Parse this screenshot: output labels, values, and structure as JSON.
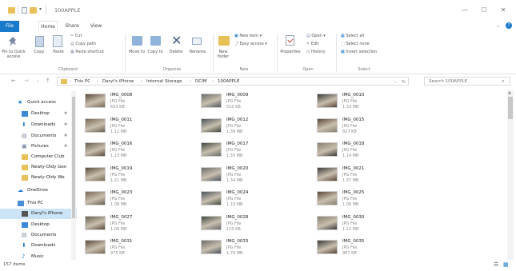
{
  "window": {
    "title": "100APPLE"
  },
  "tabs": [
    {
      "label": "File"
    },
    {
      "label": "Home"
    },
    {
      "label": "Share"
    },
    {
      "label": "View"
    }
  ],
  "ribbon": {
    "pin_label": "Pin to Quick access",
    "copy_label": "Copy",
    "paste_label": "Paste",
    "cut_label": "Cut",
    "copy_path_label": "Copy path",
    "paste_shortcut_label": "Paste shortcut",
    "move_to_label": "Move to",
    "copy_to_label": "Copy to",
    "delete_label": "Delete",
    "rename_label": "Rename",
    "new_folder_label": "New folder",
    "new_item_label": "New item",
    "easy_access_label": "Easy access",
    "properties_label": "Properties",
    "open_label": "Open",
    "edit_label": "Edit",
    "history_label": "History",
    "select_all_label": "Select all",
    "select_none_label": "Select none",
    "invert_selection_label": "Invert selection",
    "groups": [
      "Clipboard",
      "Organize",
      "New",
      "Open",
      "Select"
    ]
  },
  "address": {
    "crumbs": [
      "This PC",
      "Daryl's iPhone",
      "Internal Storage",
      "DCIM",
      "100APPLE"
    ],
    "search_placeholder": "Search 100APPLE"
  },
  "nav": [
    {
      "label": "Quick access",
      "icon": "star-icon",
      "pinned": false,
      "indent": 0
    },
    {
      "label": "Desktop",
      "icon": "desktop-icon",
      "pinned": true,
      "indent": 1
    },
    {
      "label": "Downloads",
      "icon": "download-icon",
      "pinned": true,
      "indent": 1
    },
    {
      "label": "Documents",
      "icon": "document-icon",
      "pinned": true,
      "indent": 1
    },
    {
      "label": "Pictures",
      "icon": "pictures-icon",
      "pinned": true,
      "indent": 1
    },
    {
      "label": "Computer Club",
      "icon": "folder-icon",
      "pinned": false,
      "indent": 1
    },
    {
      "label": "Newly-Oldy Gen",
      "icon": "folder-icon",
      "pinned": false,
      "indent": 1
    },
    {
      "label": "Newly-Oldy We",
      "icon": "folder-icon",
      "pinned": false,
      "indent": 1
    },
    {
      "label": "OneDrive",
      "icon": "cloud-icon",
      "pinned": false,
      "indent": 0
    },
    {
      "label": "This PC",
      "icon": "computer-icon",
      "pinned": false,
      "indent": 0
    },
    {
      "label": "Daryl's iPhone",
      "icon": "phone-icon",
      "pinned": false,
      "indent": 1,
      "selected": true
    },
    {
      "label": "Desktop",
      "icon": "desktop-icon",
      "pinned": false,
      "indent": 1
    },
    {
      "label": "Documents",
      "icon": "document-icon",
      "pinned": false,
      "indent": 1
    },
    {
      "label": "Downloads",
      "icon": "download-icon",
      "pinned": false,
      "indent": 1
    },
    {
      "label": "Music",
      "icon": "music-icon",
      "pinned": false,
      "indent": 1
    }
  ],
  "files": [
    {
      "name": "IMG_0008",
      "type": "JPG File",
      "size": "633 KB"
    },
    {
      "name": "IMG_0009",
      "type": "JPG File",
      "size": "510 KB"
    },
    {
      "name": "IMG_0010",
      "type": "JPG File",
      "size": "1.33 MB"
    },
    {
      "name": "IMG_0011",
      "type": "JPG File",
      "size": "1.12 MB"
    },
    {
      "name": "IMG_0012",
      "type": "JPG File",
      "size": "1.39 MB"
    },
    {
      "name": "IMG_0015",
      "type": "JPG File",
      "size": "827 KB"
    },
    {
      "name": "IMG_0016",
      "type": "JPG File",
      "size": "1.13 MB"
    },
    {
      "name": "IMG_0017",
      "type": "JPG File",
      "size": "1.55 MB"
    },
    {
      "name": "IMG_0018",
      "type": "JPG File",
      "size": "1.14 MB"
    },
    {
      "name": "IMG_0019",
      "type": "JPG File",
      "size": "1.21 MB"
    },
    {
      "name": "IMG_0020",
      "type": "JPG File",
      "size": "1.34 MB"
    },
    {
      "name": "IMG_0021",
      "type": "JPG File",
      "size": "1.37 MB"
    },
    {
      "name": "IMG_0023",
      "type": "JPG File",
      "size": "1.08 MB"
    },
    {
      "name": "IMG_0024",
      "type": "JPG File",
      "size": "1.10 MB"
    },
    {
      "name": "IMG_0025",
      "type": "JPG File",
      "size": "1.06 MB"
    },
    {
      "name": "IMG_0027",
      "type": "JPG File",
      "size": "1.09 MB"
    },
    {
      "name": "IMG_0028",
      "type": "JPG File",
      "size": "110 KB"
    },
    {
      "name": "IMG_0030",
      "type": "JPG File",
      "size": "1.12 MB"
    },
    {
      "name": "IMG_0031",
      "type": "JPG File",
      "size": "975 KB"
    },
    {
      "name": "IMG_0033",
      "type": "JPG File",
      "size": "1.79 MB"
    },
    {
      "name": "IMG_0035",
      "type": "JPG File",
      "size": "967 KB"
    }
  ],
  "status": {
    "count": "157 items"
  },
  "colors": {
    "accent": "#1979ca",
    "selected": "#cce4f7",
    "folder": "#e8c15a"
  }
}
